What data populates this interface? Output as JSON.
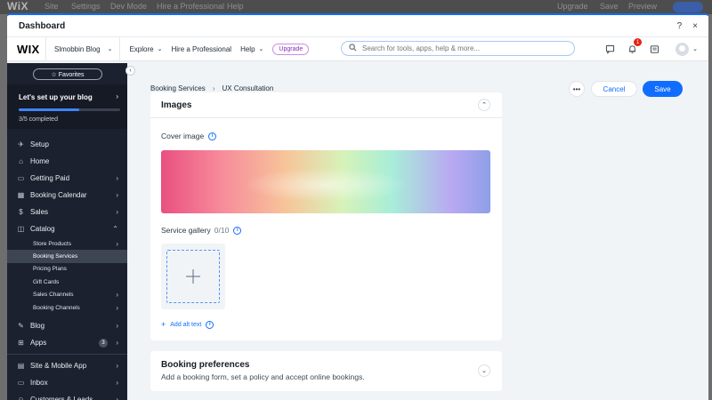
{
  "background": {
    "logo": "WiX",
    "items": [
      "Site",
      "Settings",
      "Dev Mode",
      "Hire a Professional",
      "Help"
    ],
    "right_items": [
      "Upgrade",
      "Save",
      "Preview"
    ]
  },
  "modal": {
    "title": "Dashboard",
    "help": "?",
    "close": "×"
  },
  "appbar": {
    "logo": "WIX",
    "site_name": "Slmobbin Blog",
    "nav": [
      {
        "label": "Explore"
      },
      {
        "label": "Hire a Professional"
      },
      {
        "label": "Help"
      }
    ],
    "upgrade_label": "Upgrade",
    "search_placeholder": "Search for tools, apps, help & more...",
    "notification_count": "1"
  },
  "sidebar": {
    "favorites_label": "☆ Favorites",
    "setup": {
      "title": "Let's set up your blog",
      "progress_label": "3/5 completed",
      "progress": 0.6
    },
    "items_top": [
      {
        "label": "Setup",
        "icon": "rocket-icon",
        "chevron": false
      },
      {
        "label": "Home",
        "icon": "home-icon",
        "chevron": false
      },
      {
        "label": "Getting Paid",
        "icon": "wallet-icon",
        "chevron": true
      },
      {
        "label": "Booking Calendar",
        "icon": "calendar-icon",
        "chevron": true
      },
      {
        "label": "Sales",
        "icon": "dollar-icon",
        "chevron": true
      },
      {
        "label": "Catalog",
        "icon": "box-icon",
        "chevron": true
      }
    ],
    "catalog_sub": [
      {
        "label": "Store Products",
        "chevron": true
      },
      {
        "label": "Booking Services",
        "chevron": false,
        "active": true
      },
      {
        "label": "Pricing Plans",
        "chevron": false
      },
      {
        "label": "Gift Cards",
        "chevron": false
      },
      {
        "label": "Sales Channels",
        "chevron": true
      },
      {
        "label": "Booking Channels",
        "chevron": true
      }
    ],
    "items_mid": [
      {
        "label": "Blog",
        "icon": "pen-icon"
      },
      {
        "label": "Apps",
        "icon": "apps-icon",
        "count": "3"
      }
    ],
    "items_bottom": [
      {
        "label": "Site & Mobile App",
        "icon": "layout-icon"
      },
      {
        "label": "Inbox",
        "icon": "inbox-icon"
      },
      {
        "label": "Customers & Leads",
        "icon": "people-icon"
      }
    ]
  },
  "main": {
    "breadcrumb": [
      "Booking Services",
      "UX Consultation"
    ],
    "more_label": "•••",
    "cancel_label": "Cancel",
    "save_label": "Save",
    "images_card": {
      "title": "Images",
      "cover_label": "Cover image",
      "gallery_label": "Service gallery",
      "gallery_count": "0/10",
      "alt_text_label": "Add alt text"
    },
    "booking_card": {
      "title": "Booking preferences",
      "subtitle": "Add a booking form, set a policy and accept online bookings."
    }
  },
  "colors": {
    "accent": "#116dff",
    "sidebar_bg": "#1c2130",
    "upgrade": "#8a2ab7",
    "badge": "#e62214"
  }
}
